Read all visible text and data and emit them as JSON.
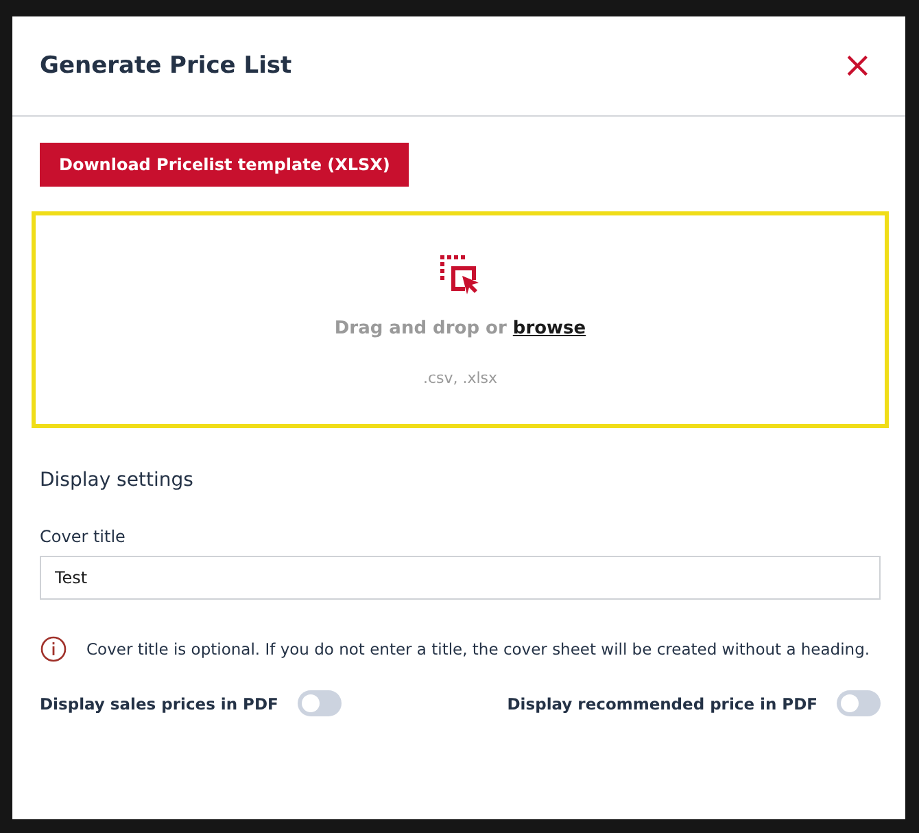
{
  "dialog": {
    "title": "Generate Price List",
    "close": "×"
  },
  "download_button": "Download Pricelist template (XLSX)",
  "dropzone": {
    "highlighted": true,
    "text": "Drag and drop or ",
    "link": "browse",
    "formats": ".csv, .xlsx"
  },
  "section_title": "Display settings",
  "cover_title": {
    "label": "Cover title",
    "value": "Test"
  },
  "info": "Cover title is optional. If you do not enter a title, the cover sheet will be created without a heading.",
  "toggles": [
    {
      "label": "Display sales prices in PDF",
      "on": false
    },
    {
      "label": "Display recommended price in PDF",
      "on": false
    }
  ]
}
